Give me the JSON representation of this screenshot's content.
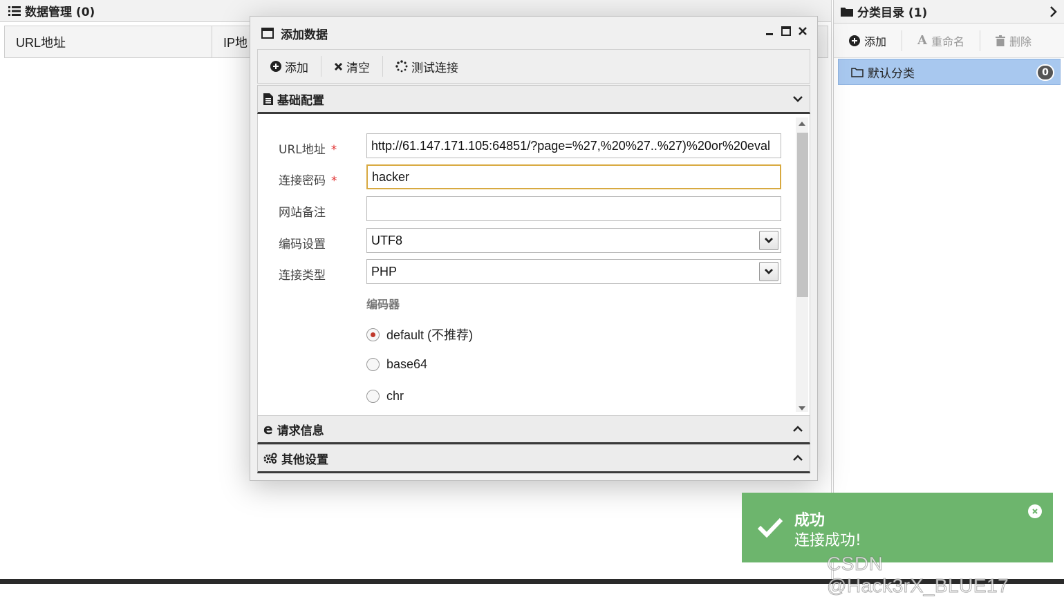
{
  "left_panel": {
    "title": "数据管理 (0)",
    "columns": [
      "URL地址",
      "IP地"
    ]
  },
  "right_panel": {
    "title": "分类目录 (1)",
    "toolbar": {
      "add": "添加",
      "rename": "重命名",
      "delete": "删除"
    },
    "categories": [
      {
        "label": "默认分类",
        "count": "0"
      }
    ]
  },
  "dialog": {
    "title": "添加数据",
    "toolbar": {
      "add": "添加",
      "clear": "清空",
      "test": "测试连接"
    },
    "sections": {
      "basic": "基础配置",
      "request": "请求信息",
      "other": "其他设置"
    },
    "form": {
      "url_label": "URL地址",
      "url_value": "http://61.147.171.105:64851/?page=%27,%20%27..%27)%20or%20eval",
      "password_label": "连接密码",
      "password_value": "hacker",
      "note_label": "网站备注",
      "note_value": "",
      "encoding_label": "编码设置",
      "encoding_value": "UTF8",
      "type_label": "连接类型",
      "type_value": "PHP",
      "encoder_label": "编码器",
      "encoders": [
        {
          "label": "default (不推荐)",
          "checked": true
        },
        {
          "label": "base64",
          "checked": false
        },
        {
          "label": "chr",
          "checked": false
        }
      ],
      "required_mark": "*"
    }
  },
  "toast": {
    "title": "成功",
    "message": "连接成功!",
    "color": "#6db56d"
  },
  "watermark": "CSDN @Hack3rX_BLUE17"
}
